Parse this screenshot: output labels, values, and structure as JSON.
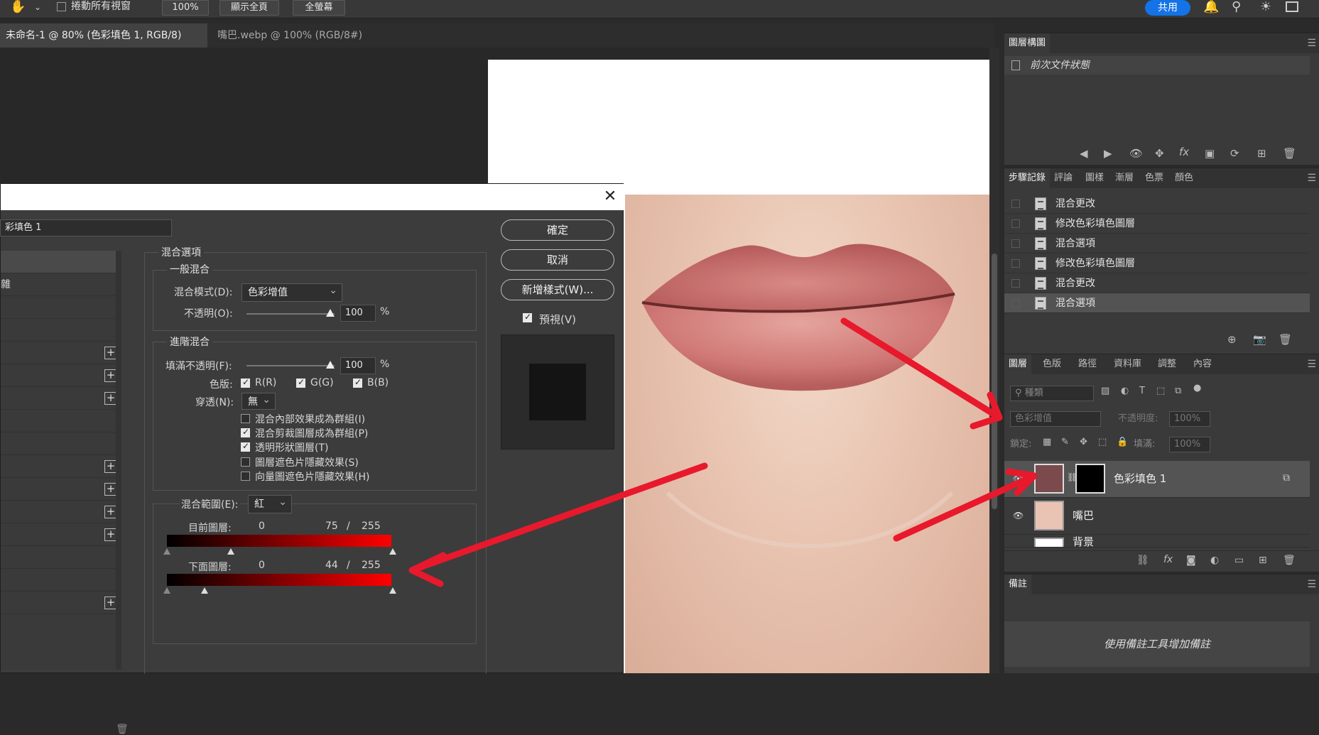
{
  "options_bar": {
    "hand_icon": "hand-icon",
    "scroll_all": "捲動所有視窗",
    "zoom_value": "100%",
    "fit_screen": "顯示全頁",
    "full_screen": "全螢幕",
    "share": "共用"
  },
  "tabs": [
    {
      "label": "未命名-1 @ 80% (色彩填色 1, RGB/8) *",
      "active": true
    },
    {
      "label": "嘴巴.webp @ 100% (RGB/8#) *",
      "active": false
    }
  ],
  "navigator_panel": {
    "tab": "圖層構圖",
    "row": "前次文件狀態"
  },
  "history_panel": {
    "tabs": [
      "步驟記錄",
      "評論",
      "圖樣",
      "漸層",
      "色票",
      "顏色"
    ],
    "items": [
      "混合更改",
      "修改色彩填色圖層",
      "混合選項",
      "修改色彩填色圖層",
      "混合更改",
      "混合選項"
    ]
  },
  "layers_panel": {
    "tabs": [
      "圖層",
      "色版",
      "路徑",
      "資料庫",
      "調整",
      "內容"
    ],
    "filter": "種類",
    "blend_mode": "色彩增值",
    "opacity_label": "不透明度:",
    "opacity": "100%",
    "lock_label": "鎖定:",
    "fill_label": "填滿:",
    "fill": "100%",
    "layers": [
      {
        "name": "色彩填色 1",
        "selected": true
      },
      {
        "name": "嘴巴",
        "selected": false
      },
      {
        "name": "背景",
        "selected": false
      }
    ]
  },
  "notes_panel": {
    "tab": "備註",
    "hint": "使用備註工具增加備註"
  },
  "dialog": {
    "style_name": "彩填色 1",
    "left_items": [
      "",
      "雜"
    ],
    "buttons": {
      "ok": "確定",
      "cancel": "取消",
      "new_style": "新增樣式(W)..."
    },
    "preview_label": "預視(V)",
    "blend_options": "混合選項",
    "general_blend": "一般混合",
    "blend_mode_label": "混合模式(D):",
    "blend_mode_value": "色彩增值",
    "opacity_label": "不透明(O):",
    "opacity_value": "100",
    "advanced_blend": "進階混合",
    "fill_opacity_label": "填滿不透明(F):",
    "fill_opacity_value": "100",
    "percent": "%",
    "channels_label": "色版:",
    "channels": [
      "R(R)",
      "G(G)",
      "B(B)"
    ],
    "knockout_label": "穿透(N):",
    "knockout_value": "無",
    "options": [
      {
        "label": "混合內部效果成為群組(I)",
        "checked": false
      },
      {
        "label": "混合剪裁圖層成為群組(P)",
        "checked": true
      },
      {
        "label": "透明形狀圖層(T)",
        "checked": true
      },
      {
        "label": "圖層遮色片隱藏效果(S)",
        "checked": false
      },
      {
        "label": "向量圖遮色片隱藏效果(H)",
        "checked": false
      }
    ],
    "blend_if_label": "混合範圍(E):",
    "blend_if_value": "紅",
    "this_layer_label": "目前圖層:",
    "this_layer_values": [
      "0",
      "75",
      "/",
      "255"
    ],
    "underlying_label": "下面圖層:",
    "underlying_values": [
      "0",
      "44",
      "/",
      "255"
    ]
  },
  "colors": {
    "accent": "#1473e6",
    "arrow": "#e8192c",
    "fill_swatch": "#7a4a4d"
  }
}
